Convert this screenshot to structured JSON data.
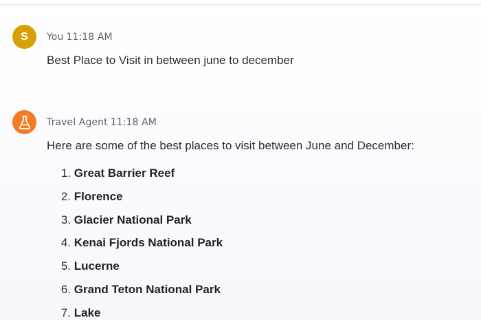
{
  "chat": {
    "messages": [
      {
        "sender": "You",
        "time": "11:18 AM",
        "avatar_letter": "S",
        "text": "Best Place to Visit in between june to december"
      },
      {
        "sender": "Travel Agent",
        "time": "11:18 AM",
        "avatar_icon": "flask-icon",
        "text": "Here are some of the best places to visit between June and December:",
        "list": [
          {
            "num": "1.",
            "name": "Great Barrier Reef"
          },
          {
            "num": "2.",
            "name": "Florence"
          },
          {
            "num": "3.",
            "name": "Glacier National Park"
          },
          {
            "num": "4.",
            "name": "Kenai Fjords National Park"
          },
          {
            "num": "5.",
            "name": "Lucerne"
          },
          {
            "num": "6.",
            "name": "Grand Teton National Park"
          },
          {
            "num": "7.",
            "name": "Lake"
          }
        ]
      }
    ]
  },
  "colors": {
    "user_avatar": "#d4a106",
    "agent_avatar": "#f47a23"
  }
}
